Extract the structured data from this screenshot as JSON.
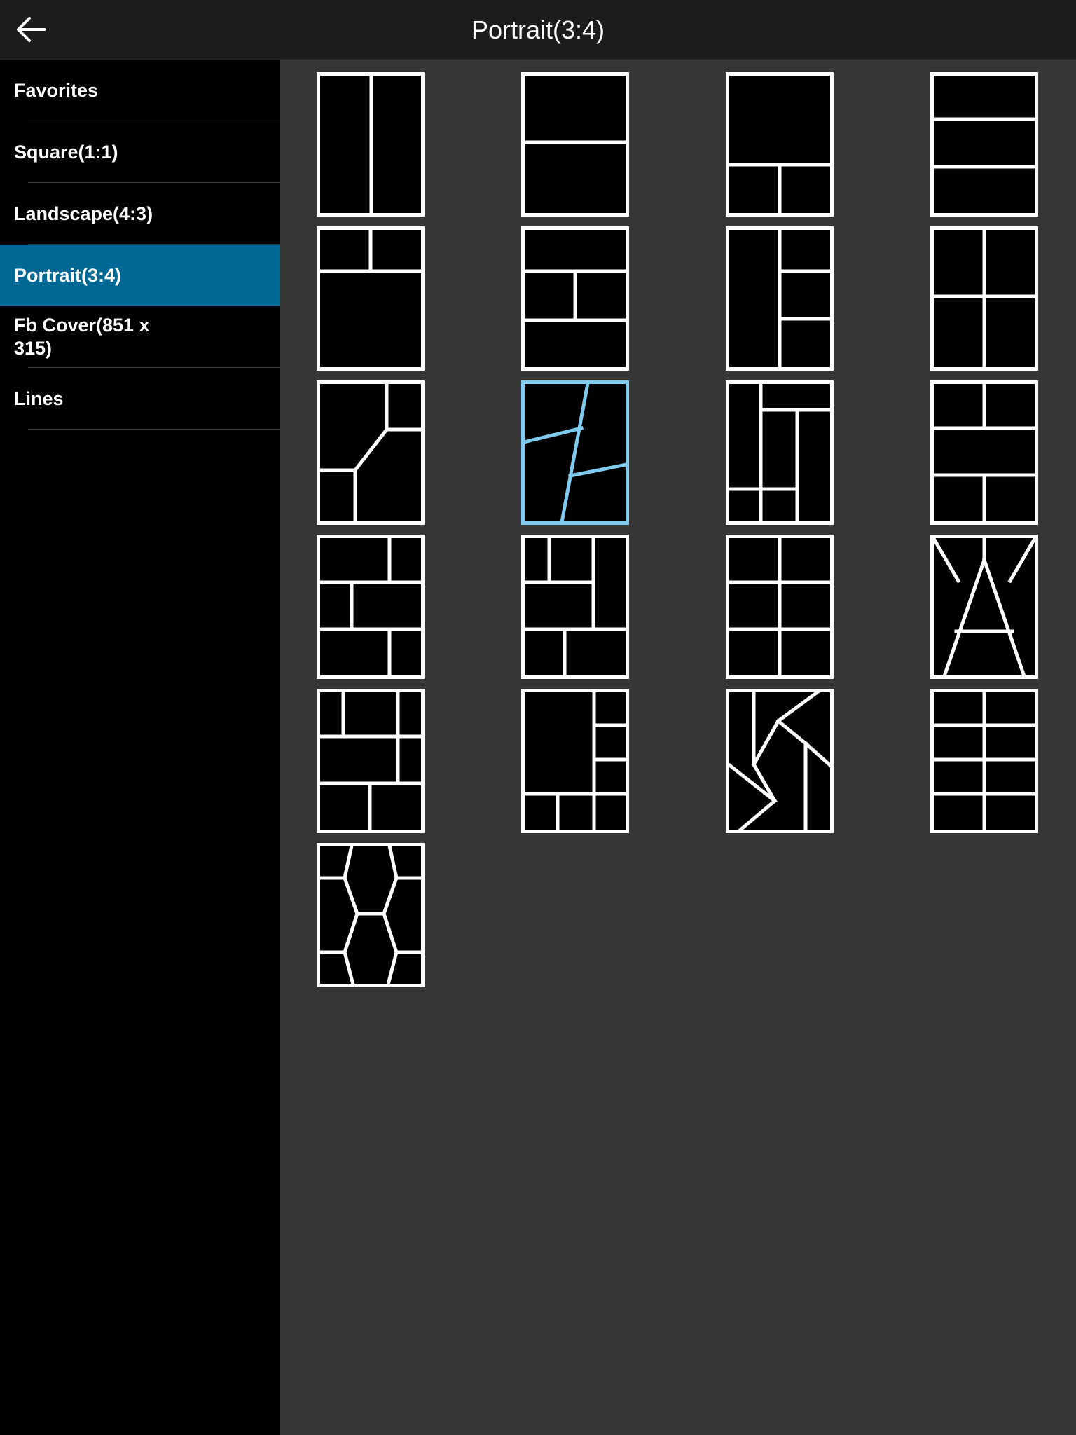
{
  "header": {
    "title": "Portrait(3:4)",
    "back_icon": "arrow-left-icon"
  },
  "sidebar": {
    "active_index": 3,
    "items": [
      {
        "label": "Favorites"
      },
      {
        "label": "Square(1:1)"
      },
      {
        "label": "Landscape(4:3)"
      },
      {
        "label": "Portrait(3:4)"
      },
      {
        "label": "Fb Cover(851 x 315)"
      },
      {
        "label": "Lines"
      }
    ]
  },
  "colors": {
    "accent": "#006894",
    "selected_outline": "#7ecbef",
    "template_line": "#ffffff",
    "content_bg": "#363636",
    "topbar_bg": "#1c1c1c"
  },
  "templates": {
    "count": 21,
    "selected_index": 9
  }
}
